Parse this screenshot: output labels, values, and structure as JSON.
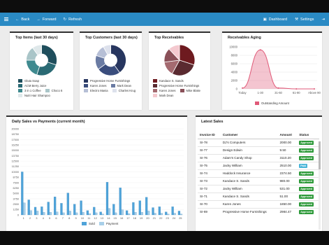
{
  "nav": {
    "back": "Back",
    "forward": "Forward",
    "refresh": "Refresh",
    "dashboard": "Dashboard",
    "settings": "Settings"
  },
  "top_items": {
    "title": "Top Items (last 30 days)",
    "legend": [
      {
        "label": "Gluta Soap",
        "color": "#1f4e5c"
      },
      {
        "label": "ACM Berry Juice",
        "color": "#2a6a74"
      },
      {
        "label": "3 in 1 Coffee",
        "color": "#3f8a8f"
      },
      {
        "label": "Choco 6",
        "color": "#a9c5c8"
      },
      {
        "label": "Nutri Hair Shampoo",
        "color": "#dfe8ea"
      }
    ]
  },
  "top_customers": {
    "title": "Top Customers (last 30 days)",
    "legend": [
      {
        "label": "Progressive Home Furnishings",
        "color": "#27365f"
      },
      {
        "label": "Karen Jones",
        "color": "#3a4d7d"
      },
      {
        "label": "Mark Dean",
        "color": "#6a7ba3"
      },
      {
        "label": "Electro Mania",
        "color": "#b6bfd6"
      },
      {
        "label": "Charles Krug",
        "color": "#dde1ec"
      }
    ]
  },
  "top_receivables": {
    "title": "Top Receivables",
    "legend": [
      {
        "label": "Kandace S. Sands",
        "color": "#6e1a1f"
      },
      {
        "label": "Progressive Home Furnishings",
        "color": "#5a2a30"
      },
      {
        "label": "Karen Jones",
        "color": "#a46a70"
      },
      {
        "label": "Mike Blake",
        "color": "#8a5058"
      },
      {
        "label": "Mark Dean",
        "color": "#f4c9cf"
      }
    ]
  },
  "receivables_aging": {
    "title": "Receivables Aging",
    "legend": "Outstanding Amount",
    "color": "#e05a78"
  },
  "daily_sales": {
    "title": "Daily Sales vs Payments (current month)",
    "legend_sold": "Sold",
    "legend_payment": "Payment",
    "sold_color": "#4fa3d9",
    "payment_color": "#a8cfe9"
  },
  "latest_sales": {
    "title": "Latest Sales",
    "columns": [
      "Invoice ID",
      "Customer",
      "Amount",
      "Status"
    ],
    "rows": [
      {
        "id": "SI-78",
        "customer": "DJ's Computers",
        "amount": "2000.00",
        "status": "Approved"
      },
      {
        "id": "SI-77",
        "customer": "Design Edwin",
        "amount": "9.50",
        "status": "Approved"
      },
      {
        "id": "SI-76",
        "customer": "Adam's Candy Shop",
        "amount": "3110.20",
        "status": "Approved"
      },
      {
        "id": "SI-75",
        "customer": "Jacky William",
        "amount": "2510.00",
        "status": "Paid"
      },
      {
        "id": "SI-74",
        "customer": "Haddock Insurance",
        "amount": "2374.50",
        "status": "Approved"
      },
      {
        "id": "SI-73",
        "customer": "Kandace S. Sands",
        "amount": "980.00",
        "status": "Approved"
      },
      {
        "id": "SI-72",
        "customer": "Jacky William",
        "amount": "531.00",
        "status": "Approved"
      },
      {
        "id": "SI-71",
        "customer": "Kandace S. Sands",
        "amount": "51.00",
        "status": "Approved"
      },
      {
        "id": "SI-70",
        "customer": "Karen Jones",
        "amount": "1850.00",
        "status": "Approved"
      },
      {
        "id": "SI-69",
        "customer": "Progressive Home Furnishings",
        "amount": "2984.47",
        "status": "Approved"
      }
    ],
    "status_colors": {
      "Approved": "#2e9a3a",
      "Paid": "#4ab5d8"
    }
  },
  "chart_data": [
    {
      "type": "pie",
      "title": "Top Items (last 30 days)",
      "labels": [
        "Gluta Soap",
        "ACM Berry Juice",
        "3 in 1 Coffee",
        "Choco 6",
        "Nutri Hair Shampoo"
      ],
      "values": [
        30,
        25,
        20,
        15,
        10
      ]
    },
    {
      "type": "pie",
      "title": "Top Customers (last 30 days)",
      "labels": [
        "Progressive Home Furnishings",
        "Karen Jones",
        "Mark Dean",
        "Electro Mania",
        "Charles Krug"
      ],
      "values": [
        40,
        25,
        15,
        12,
        8
      ]
    },
    {
      "type": "pie",
      "title": "Top Receivables",
      "labels": [
        "Kandace S. Sands",
        "Progressive Home Furnishings",
        "Karen Jones",
        "Mike Blake",
        "Mark Dean"
      ],
      "values": [
        30,
        28,
        15,
        15,
        12
      ]
    },
    {
      "type": "area",
      "title": "Receivables Aging",
      "categories": [
        "Today",
        "1-30",
        "31-60",
        "61-90",
        "Above 90"
      ],
      "values": [
        200,
        9300,
        200,
        0,
        0
      ],
      "yticks": [
        0,
        2000,
        4000,
        6000,
        8000,
        10000
      ],
      "ylim": [
        0,
        10000
      ],
      "series_name": "Outstanding Amount"
    },
    {
      "type": "bar",
      "title": "Daily Sales vs Payments (current month)",
      "categories": [
        "1",
        "2",
        "3",
        "4",
        "5",
        "6",
        "7",
        "8",
        "9",
        "10",
        "11",
        "12",
        "13",
        "14",
        "15",
        "16",
        "17",
        "18",
        "19",
        "20",
        "21",
        "22",
        "23",
        "24",
        "25"
      ],
      "series": [
        {
          "name": "Sold",
          "values": [
            10000,
            3500,
            1800,
            1900,
            3000,
            4200,
            2700,
            5100,
            2500,
            3300,
            1000,
            1800,
            700,
            7600,
            2500,
            6300,
            1000,
            2900,
            3300,
            4100,
            1700,
            1900,
            700,
            1900,
            900
          ]
        },
        {
          "name": "Payment",
          "values": [
            2800,
            1000,
            900,
            600,
            600,
            700,
            500,
            900,
            500,
            600,
            300,
            500,
            200,
            1500,
            500,
            1200,
            300,
            600,
            600,
            900,
            400,
            400,
            200,
            400,
            200
          ]
        }
      ],
      "yticks": [
        0,
        1250,
        2500,
        3750,
        5000,
        6250,
        7500,
        8750,
        10000,
        11250,
        12500,
        13750,
        15000,
        16250,
        17500,
        18750,
        20000
      ],
      "ylim": [
        0,
        20000
      ]
    }
  ]
}
